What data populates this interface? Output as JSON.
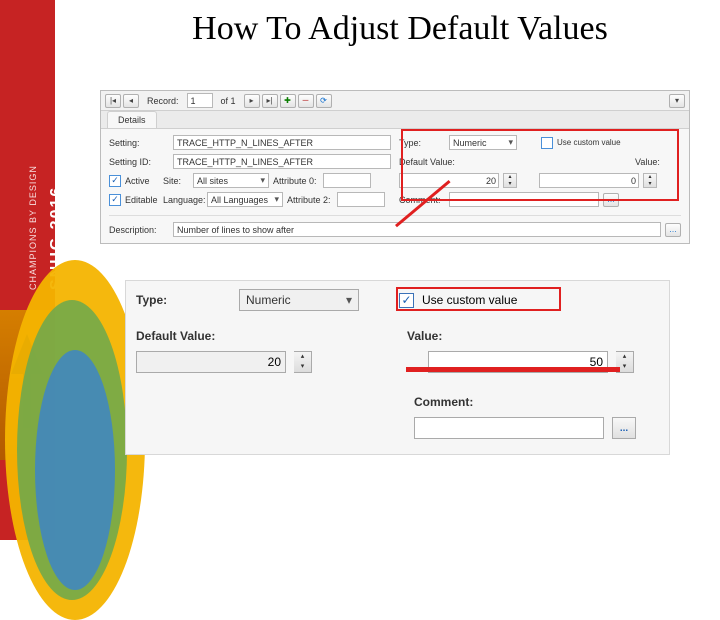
{
  "banner": {
    "main": "SNUG 2016",
    "sub": "CHAMPIONS BY DESIGN"
  },
  "title": "How To Adjust Default Values",
  "top": {
    "record_nav": {
      "pos": "1",
      "of_text": "of 1"
    },
    "tab": "Details",
    "setting_label": "Setting:",
    "setting_value": "TRACE_HTTP_N_LINES_AFTER",
    "setting_id_label": "Setting ID:",
    "setting_id_value": "TRACE_HTTP_N_LINES_AFTER",
    "active_label": "Active",
    "editable_label": "Editable",
    "site_label": "Site:",
    "site_value": "All sites",
    "language_label": "Language:",
    "language_value": "All Languages",
    "attr0_label": "Attribute 0:",
    "attr2_label": "Attribute 2:",
    "type_label": "Type:",
    "type_value": "Numeric",
    "custom_label": "Use custom value",
    "default_label": "Default Value:",
    "default_value": "20",
    "value_label": "Value:",
    "value_value": "0",
    "comment_label": "Comment:",
    "desc_label": "Description:",
    "desc_value": "Number of lines to show after"
  },
  "bot": {
    "type_label": "Type:",
    "type_value": "Numeric",
    "custom_label": "Use custom value",
    "default_label": "Default Value:",
    "default_value": "20",
    "value_label": "Value:",
    "value_value": "50",
    "comment_label": "Comment:",
    "dots": "..."
  }
}
